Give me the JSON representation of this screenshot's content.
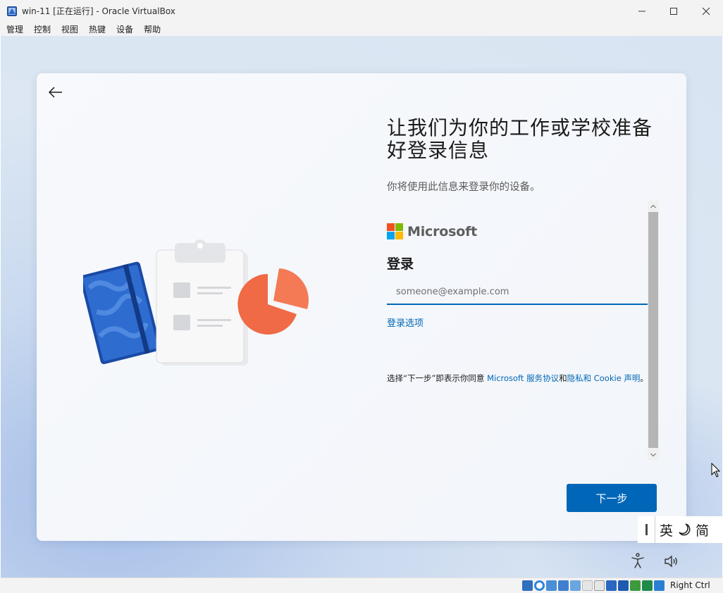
{
  "window": {
    "title": "win-11 [正在运行] - Oracle VirtualBox",
    "controls": [
      "minimize-icon",
      "maximize-icon",
      "close-icon"
    ]
  },
  "menu": {
    "items": [
      "管理",
      "控制",
      "视图",
      "热键",
      "设备",
      "帮助"
    ]
  },
  "oobe": {
    "heading": "让我们为你的工作或学校准备好登录信息",
    "subheading": "你将使用此信息来登录你的设备。",
    "signin": {
      "brand": "Microsoft",
      "title": "登录",
      "email_placeholder": "someone@example.com",
      "options_link": "登录选项",
      "terms": {
        "prefix": "选择“下一步”即表示你同意 ",
        "link1": "Microsoft 服务协议",
        "middle": "和",
        "link2": "隐私和 Cookie 声明",
        "suffix": "。"
      }
    },
    "next_button": "下一步"
  },
  "ime": {
    "mode": "英",
    "punct": "☽",
    "script": "简"
  },
  "statusbar": {
    "host_key": "Right Ctrl"
  },
  "colors": {
    "accent": "#0067b8",
    "ms_red": "#f25022",
    "ms_green": "#7fba00",
    "ms_blue": "#00a4ef",
    "ms_yellow": "#ffb900"
  }
}
